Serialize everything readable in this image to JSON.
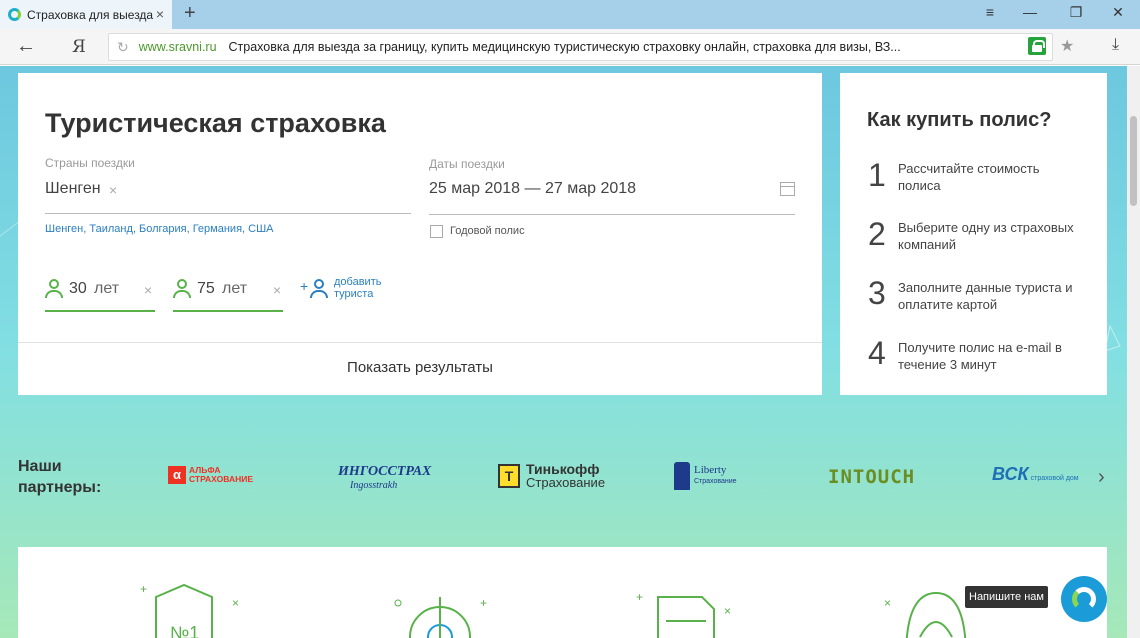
{
  "browser": {
    "tab_title": "Страховка для выезда за",
    "close_tab": "×",
    "new_tab": "+",
    "address_domain": "www.sravni.ru",
    "address_title": "Страховка для выезда за границу, купить медицинскую туристическую страховку онлайн, страховка для визы, ВЗ...",
    "yandex_label": "Я"
  },
  "form": {
    "title": "Туристическая страховка",
    "countries_label": "Страны поездки",
    "countries_value": "Шенген",
    "countries_tags": "Шенген, Таиланд, Болгария, Германия, США",
    "dates_label": "Даты поездки",
    "dates_value": "25 мар 2018 — 27 мар 2018",
    "annual_label": "Годовой полис",
    "tourist1_age": "30",
    "tourist1_unit": "лет",
    "tourist2_age": "75",
    "tourist2_unit": "лет",
    "add_tourist_line1": "добавить",
    "add_tourist_line2": "туриста",
    "show_results": "Показать результаты"
  },
  "how_to": {
    "title": "Как купить полис?",
    "steps": [
      {
        "num": "1",
        "text": "Рассчитайте стоимость полиса"
      },
      {
        "num": "2",
        "text": "Выберите одну из страховых компаний"
      },
      {
        "num": "3",
        "text": "Заполните данные туриста и оплатите картой"
      },
      {
        "num": "4",
        "text": "Получите полис на e-mail в течение 3 минут"
      }
    ]
  },
  "partners": {
    "label_line1": "Наши",
    "label_line2": "партнеры:",
    "logos": [
      {
        "name": "alfa",
        "line1": "АЛЬФА",
        "line2": "СТРАХОВАНИЕ",
        "color": "#ef3124"
      },
      {
        "name": "ingosstrakh",
        "line1": "ИНГОССТРАХ",
        "line2": "Ingosstrakh",
        "color": "#1e3a8a"
      },
      {
        "name": "tinkoff",
        "line1": "Тинькофф",
        "line2": "Страхование",
        "color": "#333333"
      },
      {
        "name": "liberty",
        "line1": "Liberty",
        "line2": "Страхование",
        "color": "#1e3a8a"
      },
      {
        "name": "intouch",
        "line1": "INTOUCH",
        "color": "#6b8e23"
      },
      {
        "name": "vsk",
        "line1": "ВСК",
        "line2": "страховой дом",
        "color": "#1e6fb5"
      }
    ]
  },
  "bottom": {
    "badge_text": "№1"
  },
  "chat": {
    "tooltip": "Напишите нам"
  },
  "colors": {
    "accent_green": "#59b14a",
    "link_blue": "#2a7fc0",
    "chat_blue": "#1b9bd8"
  }
}
